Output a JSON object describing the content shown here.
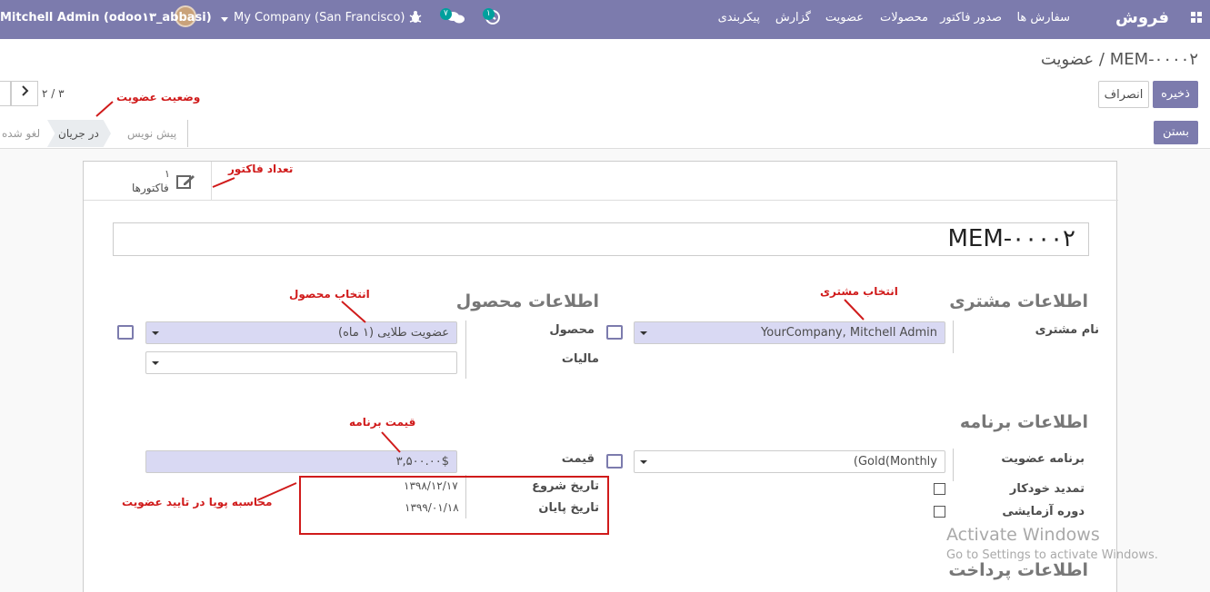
{
  "navbar": {
    "brand": "فروش",
    "menus": [
      "سفارش ها",
      "صدور فاکتور",
      "محصولات",
      "عضویت",
      "گزارش",
      "پیکربندی"
    ],
    "user": "Mitchell Admin (odoo۱۳_abbasi)",
    "company": "My Company (San Francisco)",
    "chat_count": "۷",
    "activity_count": "۱"
  },
  "breadcrumb": {
    "parent": "عضویت",
    "separator": "/",
    "current": "MEM-۰۰۰۰۲"
  },
  "buttons": {
    "save": "ذخیره",
    "discard": "انصراف",
    "close": "بستن"
  },
  "pager": {
    "value": "۲ / ۳"
  },
  "statusbar": {
    "steps": [
      "پیش نویس",
      "در جریان",
      "لغو شده"
    ],
    "active": "در جریان"
  },
  "smart_button": {
    "count": "۱",
    "label": "فاکتورها"
  },
  "record": {
    "name": "MEM-۰۰۰۰۲"
  },
  "sections": {
    "customer": "اطلاعات مشتری",
    "product": "اطلاعات محصول",
    "plan": "اطلاعات برنامه",
    "payment": "اطلاعات پرداخت"
  },
  "fields": {
    "customer_label": "نام مشتری",
    "customer_value": "YourCompany, Mitchell Admin",
    "product_label": "محصول",
    "product_value": "عضویت طلایی (۱ ماه)",
    "taxes_label": "مالیات",
    "plan_label": "برنامه عضویت",
    "plan_value": "(Gold(Monthly",
    "autorenew_label": "تمدید خودکار",
    "trial_label": "دوره آزمایشی",
    "price_label": "قیمت",
    "price_value": "۳,۵۰۰.۰۰$",
    "start_label": "تاریخ شروع",
    "start_value": "۱۳۹۸/۱۲/۱۷",
    "end_label": "تاریخ پایان",
    "end_value": "۱۳۹۹/۰۱/۱۸"
  },
  "annotations": {
    "status": "وضعیت عضویت",
    "invoices": "تعداد فاکتور",
    "product": "انتخاب محصول",
    "customer": "انتخاب مشتری",
    "price": "قیمت برنامه",
    "dynamic": "محاسبه پویا در تایید عضویت"
  },
  "watermark": {
    "title": "Activate Windows",
    "subtitle": "Go to Settings to activate Windows."
  },
  "colors": {
    "brand": "#7c7bad",
    "annotation": "#d01b1b"
  }
}
